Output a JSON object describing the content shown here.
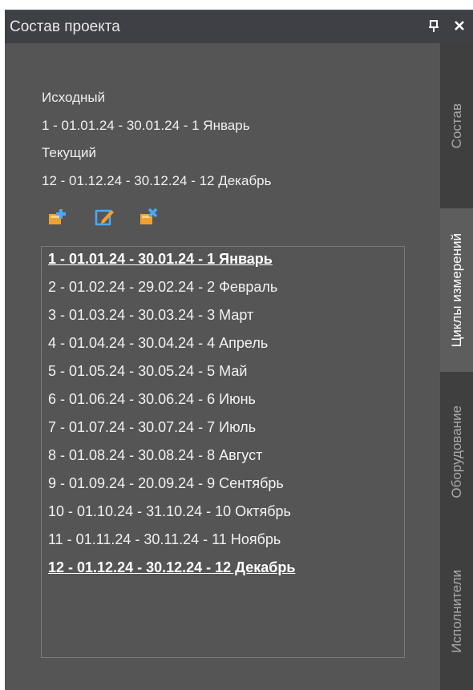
{
  "window": {
    "title": "Состав проекта"
  },
  "side_tabs": [
    {
      "label": "Состав",
      "active": false
    },
    {
      "label": "Циклы измерений",
      "active": true
    },
    {
      "label": "Оборудование",
      "active": false
    },
    {
      "label": "Исполнители",
      "active": false
    }
  ],
  "info": {
    "original_label": "Исходный",
    "original_value": "1 - 01.01.24 - 30.01.24 - 1 Январь",
    "current_label": "Текущий",
    "current_value": "12 - 01.12.24 - 30.12.24 - 12 Декабрь"
  },
  "toolbar": {
    "icons": [
      "add-icon",
      "edit-icon",
      "delete-icon"
    ],
    "accent_orange": "#f0a030",
    "accent_blue": "#4aa8ff"
  },
  "cycles": [
    {
      "text": "1 - 01.01.24 - 30.01.24 - 1 Январь",
      "selected": true
    },
    {
      "text": "2 - 01.02.24 - 29.02.24 - 2 Февраль",
      "selected": false
    },
    {
      "text": "3 - 01.03.24 - 30.03.24 - 3 Март",
      "selected": false
    },
    {
      "text": "4 - 01.04.24 - 30.04.24 - 4 Апрель",
      "selected": false
    },
    {
      "text": "5 - 01.05.24 - 30.05.24 - 5 Май",
      "selected": false
    },
    {
      "text": "6 - 01.06.24 - 30.06.24 - 6 Июнь",
      "selected": false
    },
    {
      "text": "7 - 01.07.24 - 30.07.24 - 7 Июль",
      "selected": false
    },
    {
      "text": "8 - 01.08.24 - 30.08.24 - 8 Август",
      "selected": false
    },
    {
      "text": "9 - 01.09.24 - 20.09.24 - 9 Сентябрь",
      "selected": false
    },
    {
      "text": "10 - 01.10.24 - 31.10.24 - 10 Октябрь",
      "selected": false
    },
    {
      "text": "11 - 01.11.24 - 30.11.24 - 11 Ноябрь",
      "selected": false
    },
    {
      "text": "12 - 01.12.24 - 30.12.24 - 12 Декабрь",
      "selected": true
    }
  ]
}
